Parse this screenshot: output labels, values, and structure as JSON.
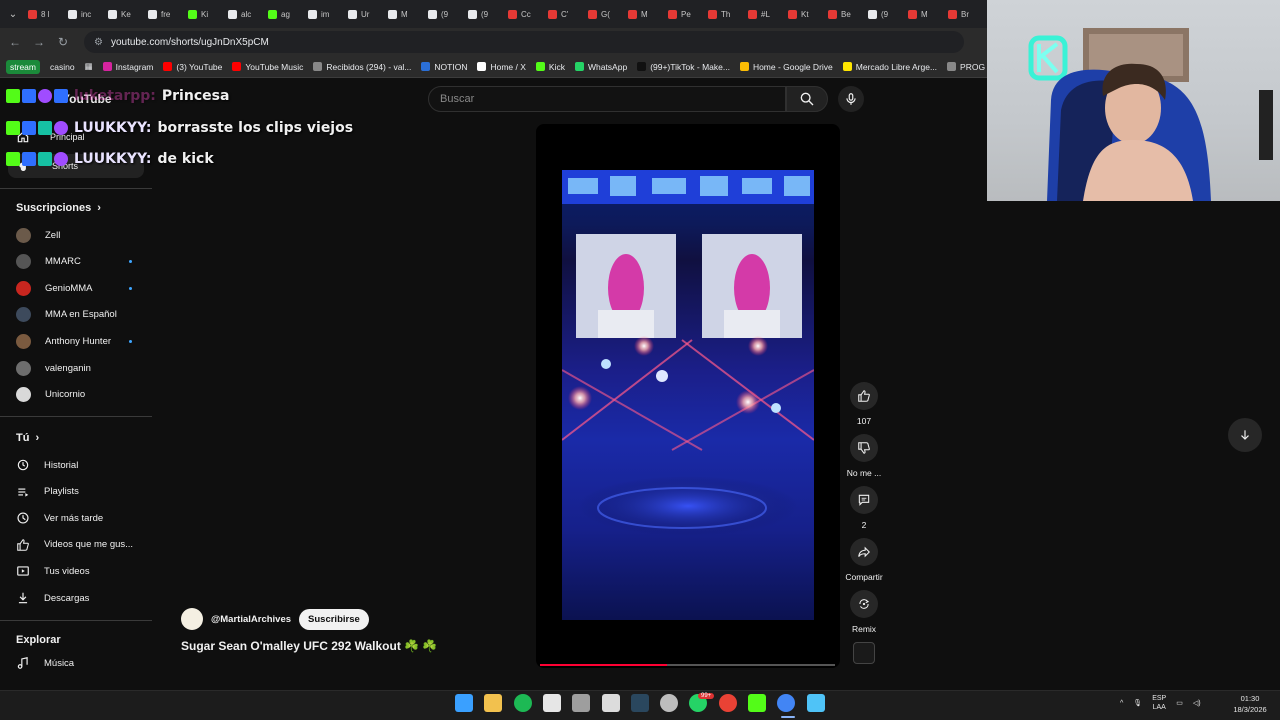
{
  "browser": {
    "tabs": [
      "8 l",
      "inc",
      "Ke",
      "fre",
      "Ki",
      "alc",
      "ag",
      "im",
      "Ur",
      "M",
      "(9",
      "(9",
      "Cc",
      "C'",
      "G(",
      "M",
      "Pe",
      "Th",
      "#L",
      "Kt",
      "Be",
      "(9",
      "M",
      "Br"
    ],
    "url": "youtube.com/shorts/ugJnDnX5pCM",
    "bookmarks": [
      "stream",
      "casino",
      "Instagram",
      "(3) YouTube",
      "YouTube Music",
      "Recibidos (294) - val...",
      "NOTION",
      "Home / X",
      "Kick",
      "WhatsApp",
      "(99+)TikTok - Make...",
      "Home - Google Drive",
      "Mercado Libre Arge...",
      "PROG"
    ]
  },
  "youtube": {
    "logo": "YouTube",
    "search_placeholder": "Buscar",
    "nav_top": [
      "Principal",
      "Shorts"
    ]
  },
  "chat_overlay": [
    {
      "user": "luketarpp:",
      "message": "Princesa"
    },
    {
      "user": "LUUKKYY:",
      "message": "borrasste los clips viejos"
    },
    {
      "user": "LUUKKYY:",
      "message": "de kick"
    }
  ],
  "sidebar": {
    "subscriptions_heading": "Suscripciones",
    "subscriptions": [
      {
        "name": "Zell",
        "color": "#6b5a4a",
        "new": false
      },
      {
        "name": "MMARC",
        "color": "#555555",
        "new": true
      },
      {
        "name": "GenioMMA",
        "color": "#c8261f",
        "new": true
      },
      {
        "name": "MMA en Español",
        "color": "#3d4a5c",
        "new": false
      },
      {
        "name": "Anthony Hunter",
        "color": "#7a5a3f",
        "new": true
      },
      {
        "name": "valenganin",
        "color": "#6d6d6d",
        "new": false
      },
      {
        "name": "Unicornio",
        "color": "#d9d9d9",
        "new": false
      }
    ],
    "you_heading": "Tú",
    "you_items": [
      {
        "label": "Historial",
        "icon": "history-icon"
      },
      {
        "label": "Playlists",
        "icon": "playlists-icon"
      },
      {
        "label": "Ver más tarde",
        "icon": "watch-later-icon"
      },
      {
        "label": "Videos que me gus...",
        "icon": "liked-videos-icon"
      },
      {
        "label": "Tus videos",
        "icon": "your-videos-icon"
      },
      {
        "label": "Descargas",
        "icon": "downloads-icon"
      }
    ],
    "explore_heading": "Explorar",
    "explore_items": [
      {
        "label": "Música",
        "icon": "music-icon"
      }
    ]
  },
  "short": {
    "channel": "@MartialArchives",
    "subscribe_label": "Suscribirse",
    "title": "Sugar Sean O'malley UFC 292 Walkout ☘️ ☘️",
    "progress": 0.43,
    "actions": {
      "like_count": "107",
      "dislike_label": "No me ...",
      "comments_count": "2",
      "share_label": "Compartir",
      "remix_label": "Remix"
    }
  },
  "taskbar": {
    "tray": {
      "lang_top": "ESP",
      "lang_bottom": "LAA"
    },
    "time": "01:30",
    "date": "18/3/2026",
    "badge": "99+"
  },
  "colors": {
    "background": "#0f0f0f",
    "accent_red": "#ff0033",
    "kick_green": "#53fc18"
  }
}
